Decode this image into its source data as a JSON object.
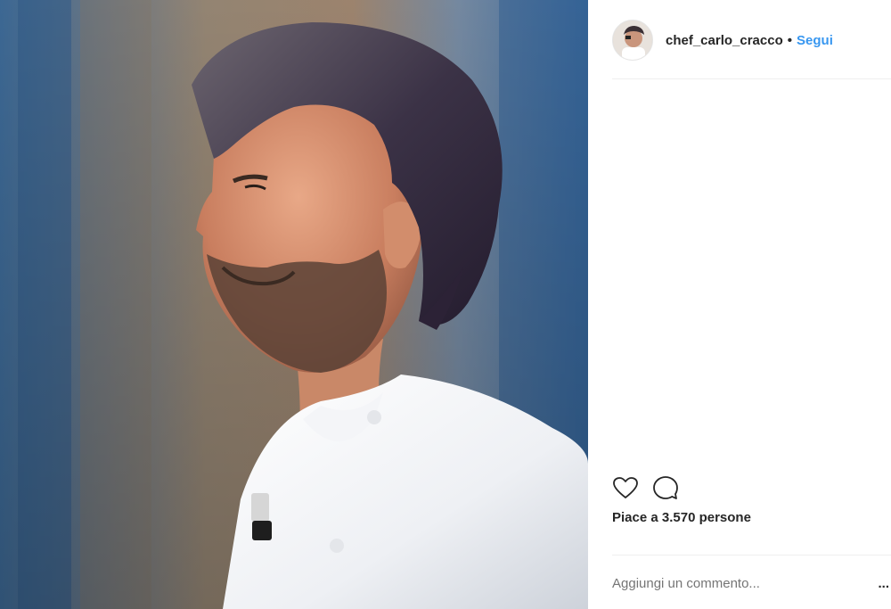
{
  "post": {
    "username": "chef_carlo_cracco",
    "separator": "•",
    "follow_label": "Segui",
    "likes_text": "Piace a 3.570 persone",
    "comment_placeholder": "Aggiungi un commento...",
    "more_label": "..."
  },
  "icons": {
    "like": "heart-icon",
    "comment": "speech-bubble-icon",
    "save": "bookmark-icon"
  },
  "colors": {
    "follow": "#3897f0",
    "text": "#262626",
    "muted": "#999999",
    "divider": "#efefef"
  }
}
